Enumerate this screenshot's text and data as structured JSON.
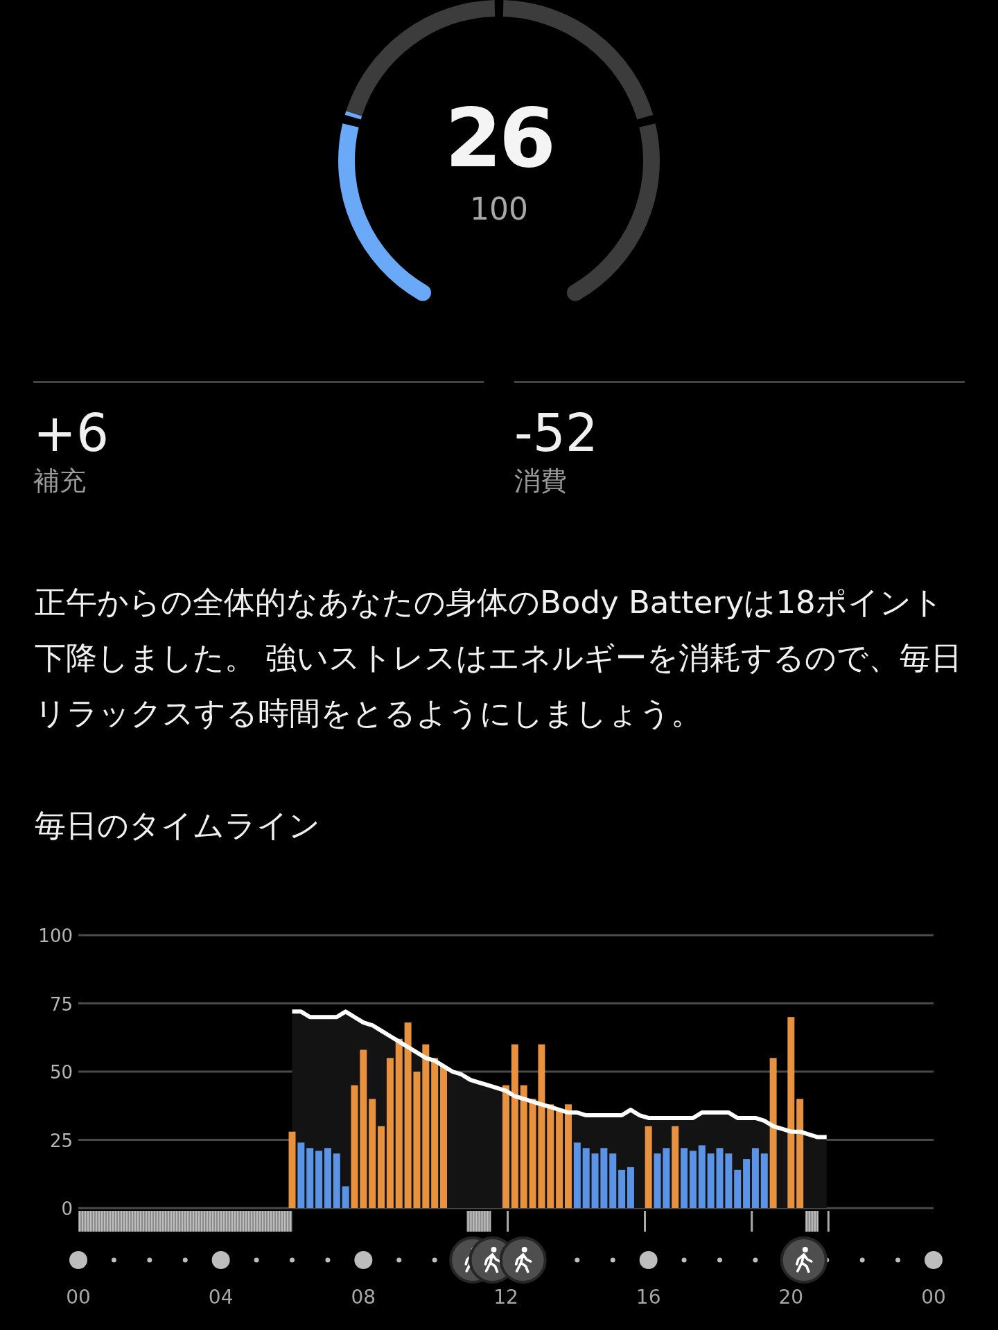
{
  "gauge": {
    "value": "26",
    "max": "100"
  },
  "stats": [
    {
      "value": "+6",
      "label": "補充"
    },
    {
      "value": "-52",
      "label": "消費"
    }
  ],
  "summary": "正午からの全体的なあなたの身体のBody Batteryは18ポイント下降しました。 強いストレスはエネルギーを消耗するので、毎日リラックスする時間をとるようにしましょう。",
  "timeline": {
    "title": "毎日のタイムライン",
    "chart_data": {
      "type": "bar",
      "x": [
        6,
        6.25,
        6.5,
        6.75,
        7,
        7.25,
        7.5,
        7.75,
        8,
        8.25,
        8.5,
        8.75,
        9,
        9.25,
        9.5,
        9.75,
        10,
        10.25,
        10.5,
        10.75,
        11,
        11.25,
        11.5,
        11.75,
        12,
        12.25,
        12.5,
        12.75,
        13,
        13.25,
        13.5,
        13.75,
        14,
        14.25,
        14.5,
        14.75,
        15,
        15.25,
        15.5,
        15.75,
        16,
        16.25,
        16.5,
        16.75,
        17,
        17.25,
        17.5,
        17.75,
        18,
        18.25,
        18.5,
        18.75,
        19,
        19.25,
        19.5,
        19.75,
        20,
        20.25,
        20.5,
        20.75,
        21
      ],
      "series": [
        {
          "type": "area",
          "color": "#ffffff",
          "values": [
            72,
            72,
            70,
            70,
            70,
            70,
            72,
            70,
            68,
            67,
            65,
            63,
            61,
            59,
            57,
            55,
            54,
            52,
            50,
            49,
            47,
            46,
            45,
            44,
            43,
            41,
            40,
            39,
            38,
            37,
            36,
            35,
            35,
            34,
            34,
            34,
            34,
            34,
            36,
            34,
            33,
            33,
            33,
            33,
            33,
            33,
            35,
            35,
            35,
            35,
            33,
            33,
            33,
            32,
            30,
            29,
            28,
            28,
            27,
            26,
            26
          ]
        },
        {
          "type": "bar",
          "color": "#5b93e6",
          "values": [
            null,
            24,
            22,
            21,
            22,
            20,
            8,
            null,
            null,
            null,
            null,
            null,
            null,
            null,
            null,
            null,
            null,
            null,
            null,
            null,
            null,
            null,
            null,
            null,
            null,
            null,
            null,
            null,
            null,
            null,
            null,
            null,
            24,
            22,
            20,
            22,
            20,
            14,
            15,
            null,
            null,
            20,
            22,
            null,
            22,
            21,
            23,
            20,
            22,
            20,
            14,
            18,
            22,
            20,
            null,
            null,
            null,
            null,
            null,
            null,
            null
          ]
        },
        {
          "type": "bar",
          "color": "#e8913f",
          "values": [
            28,
            null,
            null,
            null,
            null,
            null,
            null,
            45,
            58,
            40,
            30,
            55,
            62,
            68,
            50,
            60,
            55,
            52,
            null,
            null,
            null,
            null,
            null,
            null,
            45,
            60,
            45,
            40,
            60,
            38,
            36,
            38,
            null,
            null,
            null,
            null,
            null,
            null,
            null,
            null,
            30,
            null,
            null,
            30,
            null,
            null,
            null,
            null,
            null,
            null,
            null,
            null,
            null,
            null,
            55,
            null,
            70,
            40,
            null,
            null,
            null
          ]
        }
      ],
      "xlim": [
        0,
        24
      ],
      "ylim": [
        0,
        100
      ],
      "xticks": [
        {
          "value": 0,
          "label": "00"
        },
        {
          "value": 4,
          "label": "04"
        },
        {
          "value": 8,
          "label": "08"
        },
        {
          "value": 12,
          "label": "12"
        },
        {
          "value": 16,
          "label": "16"
        },
        {
          "value": 20,
          "label": "20"
        },
        {
          "value": 24,
          "label": "00"
        }
      ],
      "yticks": [
        0,
        25,
        50,
        75,
        100
      ],
      "grid": true
    }
  }
}
